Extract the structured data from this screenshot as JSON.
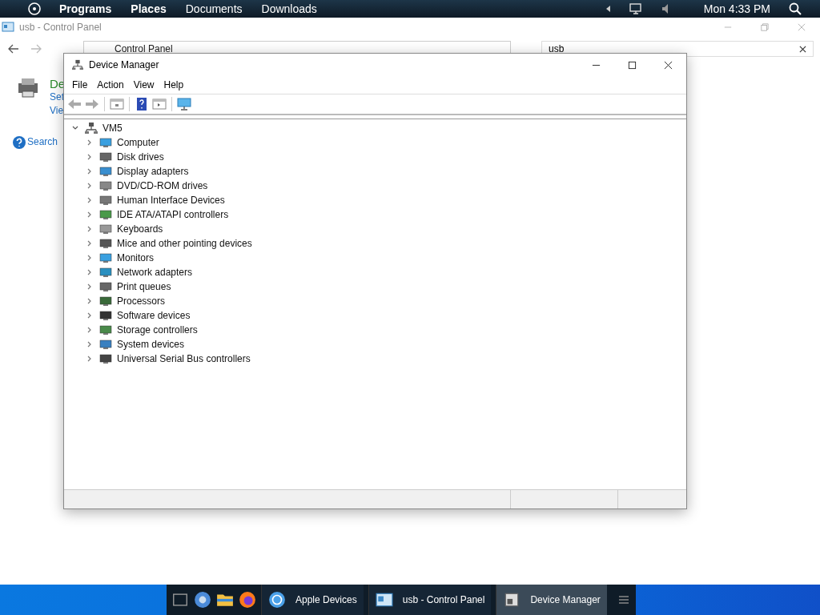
{
  "top_bar": {
    "menus": [
      "Programs",
      "Places",
      "Documents",
      "Downloads"
    ],
    "clock": "Mon 4:33 PM"
  },
  "control_panel": {
    "title": "usb - Control Panel",
    "address": "Control Panel",
    "search": "usb",
    "heading": "De",
    "links": [
      "Set",
      "Vie"
    ],
    "search_link": "Search"
  },
  "device_manager": {
    "title": "Device Manager",
    "menu": [
      "File",
      "Action",
      "View",
      "Help"
    ],
    "tree": {
      "label": "VM5",
      "expanded": true,
      "children": [
        {
          "label": "Computer",
          "expanded": false
        },
        {
          "label": "Disk drives",
          "expanded": false
        },
        {
          "label": "Display adapters",
          "expanded": false
        },
        {
          "label": "DVD/CD-ROM drives",
          "expanded": false
        },
        {
          "label": "Human Interface Devices",
          "expanded": false
        },
        {
          "label": "IDE ATA/ATAPI controllers",
          "expanded": false
        },
        {
          "label": "Keyboards",
          "expanded": false
        },
        {
          "label": "Mice and other pointing devices",
          "expanded": false
        },
        {
          "label": "Monitors",
          "expanded": false
        },
        {
          "label": "Network adapters",
          "expanded": false
        },
        {
          "label": "Print queues",
          "expanded": false
        },
        {
          "label": "Processors",
          "expanded": false
        },
        {
          "label": "Software devices",
          "expanded": false
        },
        {
          "label": "Storage controllers",
          "expanded": false
        },
        {
          "label": "System devices",
          "expanded": false
        },
        {
          "label": "Universal Serial Bus controllers",
          "expanded": false
        }
      ]
    }
  },
  "taskbar": {
    "items": [
      {
        "label": "Apple Devices",
        "selected": false
      },
      {
        "label": "usb - Control Panel",
        "selected": false
      },
      {
        "label": "Device Manager",
        "selected": true
      }
    ]
  }
}
